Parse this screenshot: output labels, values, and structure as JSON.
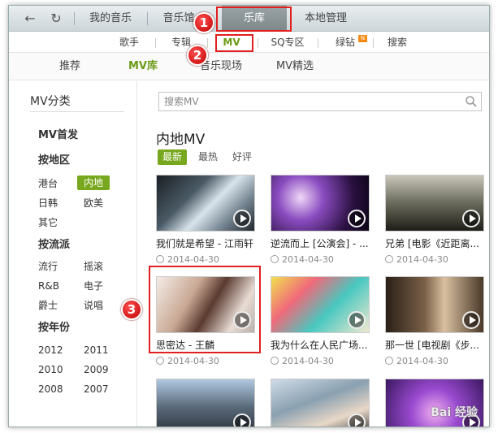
{
  "topbar": {
    "tabs": [
      {
        "label": "我的音乐"
      },
      {
        "label": "音乐馆"
      },
      {
        "label": "乐库"
      },
      {
        "label": "本地管理"
      }
    ]
  },
  "subnav": {
    "items": [
      {
        "label": "歌手"
      },
      {
        "label": "专辑"
      },
      {
        "label": "MV"
      },
      {
        "label": "SQ专区"
      },
      {
        "label": "绿钻"
      },
      {
        "label": "搜索"
      }
    ],
    "badge": "N"
  },
  "thirdnav": {
    "items": [
      {
        "label": "推荐"
      },
      {
        "label": "MV库"
      },
      {
        "label": "音乐现场"
      },
      {
        "label": "MV精选"
      }
    ]
  },
  "sidebar": {
    "title": "MV分类",
    "first": "MV首发",
    "region_heading": "按地区",
    "regions": [
      "港台",
      "内地",
      "日韩",
      "欧美",
      "其它"
    ],
    "genre_heading": "按流派",
    "genres": [
      "流行",
      "摇滚",
      "R&B",
      "电子",
      "爵士",
      "说唱"
    ],
    "year_heading": "按年份",
    "years": [
      "2012",
      "2011",
      "2010",
      "2009",
      "2008",
      "2007"
    ]
  },
  "main": {
    "search_placeholder": "搜索MV",
    "section_title": "内地MV",
    "filters": [
      "最新",
      "最热",
      "好评"
    ],
    "cards": [
      {
        "title": "我们就是希望 - 江雨轩",
        "date": "2014-04-30"
      },
      {
        "title": "逆流而上 [公演会] - ...",
        "date": "2014-04-30"
      },
      {
        "title": "兄弟 [电影《近距离...",
        "date": "2014-04-30"
      },
      {
        "title": "思密达 - 王麟",
        "date": "2014-04-30"
      },
      {
        "title": "我为什么在人民广场...",
        "date": "2014-04-30"
      },
      {
        "title": "那一世 [电视剧《步...",
        "date": "2014-04-30"
      },
      {
        "title": "",
        "date": ""
      },
      {
        "title": "",
        "date": ""
      },
      {
        "title": "",
        "date": ""
      }
    ]
  },
  "annotations": {
    "markers": [
      "1",
      "2",
      "3"
    ]
  },
  "watermark": "Bai 经验",
  "colors": {
    "accent": "#77a81d",
    "highlight": "#e02020",
    "active_tab": "#8a9396"
  }
}
